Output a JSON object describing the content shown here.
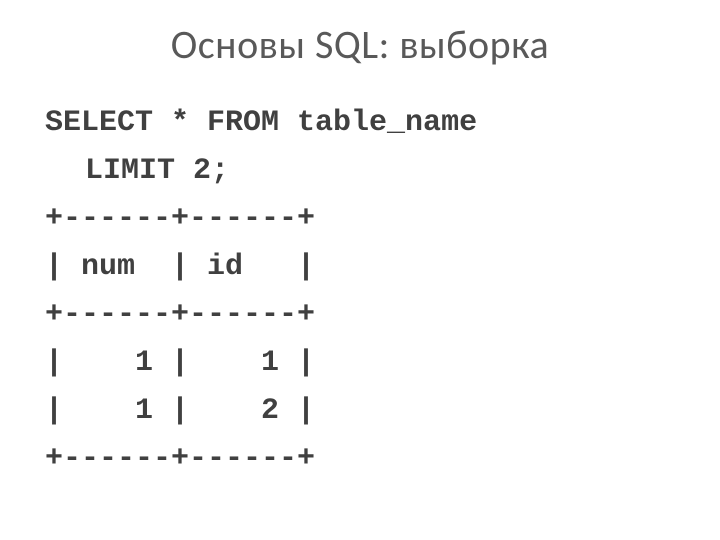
{
  "title": "Основы SQL: выборка",
  "code": {
    "line1": "SELECT * FROM table_name",
    "line2": "LIMIT 2;",
    "border_top": "+------+------+",
    "header": "| num  | id   |",
    "border_mid": "+------+------+",
    "row1": "|    1 |    1 |",
    "row2": "|    1 |    2 |",
    "border_bot": "+------+------+"
  }
}
